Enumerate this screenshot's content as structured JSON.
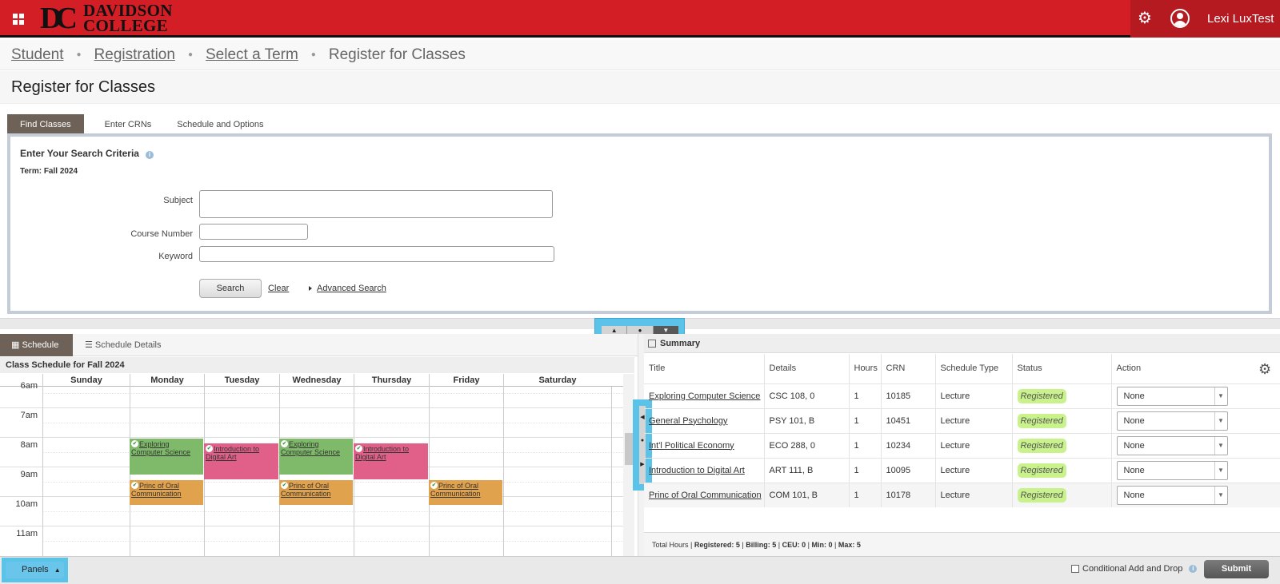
{
  "header": {
    "logo_mono": "DC",
    "logo_line1": "DAVIDSON",
    "logo_line2": "COLLEGE",
    "user_name": "Lexi LuxTest",
    "brand_color": "#d31e25"
  },
  "breadcrumb": [
    "Student",
    "Registration",
    "Select a Term",
    "Register for Classes"
  ],
  "page_title": "Register for Classes",
  "tabs": [
    "Find Classes",
    "Enter CRNs",
    "Schedule and Options"
  ],
  "search": {
    "title": "Enter Your Search Criteria",
    "term": "Term: Fall 2024",
    "subject_label": "Subject",
    "course_number_label": "Course Number",
    "keyword_label": "Keyword",
    "search_button": "Search",
    "clear_link": "Clear",
    "advanced_link": "Advanced Search"
  },
  "schedule": {
    "tab_schedule": "Schedule",
    "tab_details": "Schedule Details",
    "title": "Class Schedule for Fall 2024",
    "days": [
      "Sunday",
      "Monday",
      "Tuesday",
      "Wednesday",
      "Thursday",
      "Friday",
      "Saturday"
    ],
    "times": [
      "6am",
      "7am",
      "8am",
      "9am",
      "10am",
      "11am"
    ],
    "events": [
      {
        "name": "Exploring Computer Science",
        "day": "Monday",
        "color": "green"
      },
      {
        "name": "Introduction to Digital Art",
        "day": "Tuesday",
        "color": "pink"
      },
      {
        "name": "Exploring Computer Science",
        "day": "Wednesday",
        "color": "green"
      },
      {
        "name": "Introduction to Digital Art",
        "day": "Thursday",
        "color": "pink"
      },
      {
        "name": "Princ of Oral Communication",
        "day": "Monday",
        "color": "orange"
      },
      {
        "name": "Princ of Oral Communication",
        "day": "Wednesday",
        "color": "orange"
      },
      {
        "name": "Princ of Oral Communication",
        "day": "Friday",
        "color": "orange"
      }
    ]
  },
  "summary": {
    "title": "Summary",
    "columns": [
      "Title",
      "Details",
      "Hours",
      "CRN",
      "Schedule Type",
      "Status",
      "Action"
    ],
    "rows": [
      {
        "title": "Exploring Computer Science",
        "details": "CSC 108, 0",
        "hours": "1",
        "crn": "10185",
        "type": "Lecture",
        "status": "Registered",
        "action": "None"
      },
      {
        "title": "General Psychology",
        "details": "PSY 101, B",
        "hours": "1",
        "crn": "10451",
        "type": "Lecture",
        "status": "Registered",
        "action": "None"
      },
      {
        "title": "Int'l Political Economy",
        "details": "ECO 288, 0",
        "hours": "1",
        "crn": "10234",
        "type": "Lecture",
        "status": "Registered",
        "action": "None"
      },
      {
        "title": "Introduction to Digital Art",
        "details": "ART 111, B",
        "hours": "1",
        "crn": "10095",
        "type": "Lecture",
        "status": "Registered",
        "action": "None"
      },
      {
        "title": "Princ of Oral Communication",
        "details": "COM 101, B",
        "hours": "1",
        "crn": "10178",
        "type": "Lecture",
        "status": "Registered",
        "action": "None"
      }
    ],
    "footer_prefix": "Total Hours | ",
    "footer_parts": [
      {
        "label": "Registered:",
        "value": "5"
      },
      {
        "label": "Billing:",
        "value": "5"
      },
      {
        "label": "CEU:",
        "value": "0"
      },
      {
        "label": "Min:",
        "value": "0"
      },
      {
        "label": "Max:",
        "value": "5"
      }
    ]
  },
  "bottom": {
    "panels": "Panels",
    "conditional": "Conditional Add and Drop",
    "submit": "Submit"
  }
}
